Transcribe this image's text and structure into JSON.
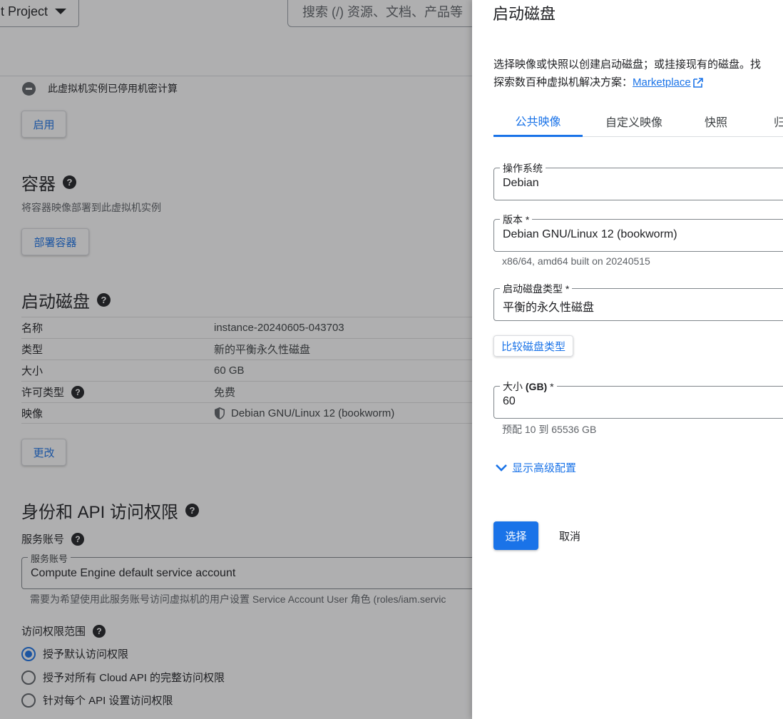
{
  "background": {
    "project_label": "t Project",
    "search_placeholder": "搜索 (/) 资源、文档、产品等",
    "confidential": {
      "text": "此虚拟机实例已停用机密计算",
      "enable_button": "启用"
    },
    "container": {
      "title": "容器",
      "description": "将容器映像部署到此虚拟机实例",
      "deploy_button": "部署容器"
    },
    "boot_disk": {
      "title": "启动磁盘",
      "rows": [
        {
          "key": "名称",
          "value": "instance-20240605-043703"
        },
        {
          "key": "类型",
          "value": "新的平衡永久性磁盘"
        },
        {
          "key": "大小",
          "value": "60 GB"
        },
        {
          "key": "许可类型",
          "value": "免费"
        },
        {
          "key": "映像",
          "value": "Debian GNU/Linux 12 (bookworm)"
        }
      ],
      "change_button": "更改"
    },
    "identity": {
      "title": "身份和 API 访问权限",
      "service_account_label": "服务账号",
      "service_account_field_legend": "服务账号",
      "service_account_value": "Compute Engine default service account",
      "service_account_hint": "需要为希望使用此服务账号访问虚拟机的用户设置 Service Account User 角色 (roles/iam.servic",
      "access_scope_label": "访问权限范围",
      "scopes": [
        {
          "label": "授予默认访问权限",
          "selected": true
        },
        {
          "label": "授予对所有 Cloud API 的完整访问权限",
          "selected": false
        },
        {
          "label": "针对每个 API 设置访问权限",
          "selected": false
        }
      ]
    }
  },
  "drawer": {
    "title": "启动磁盘",
    "intro_line1": "选择映像或快照以创建启动磁盘；或挂接现有的磁盘。找",
    "intro_line2_prefix": "探索数百种虚拟机解决方案：",
    "marketplace_link": "Marketplace",
    "tabs": [
      {
        "label": "公共映像",
        "active": true
      },
      {
        "label": "自定义映像",
        "active": false
      },
      {
        "label": "快照",
        "active": false
      },
      {
        "label": "归",
        "active": false
      }
    ],
    "os": {
      "legend": "操作系统",
      "value": "Debian"
    },
    "version": {
      "legend": "版本 *",
      "value": "Debian GNU/Linux 12 (bookworm)",
      "hint": "x86/64, amd64 built on 20240515"
    },
    "disk_type": {
      "legend": "启动磁盘类型 *",
      "value": "平衡的永久性磁盘"
    },
    "compare_button": "比较磁盘类型",
    "size": {
      "legend_prefix": "大小 ",
      "legend_bold": "(GB)",
      "legend_suffix": " *",
      "value": "60",
      "hint": "预配 10 到 65536 GB"
    },
    "advanced_toggle": "显示高级配置",
    "select_button": "选择",
    "cancel_button": "取消"
  },
  "colors": {
    "accent": "#1a73e8",
    "scrim": "rgba(32,33,36,0.36)"
  }
}
